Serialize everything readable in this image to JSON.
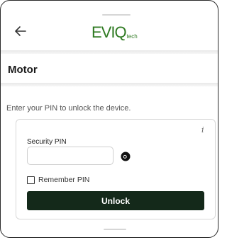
{
  "header": {
    "back_icon": "arrow-left-icon",
    "logo_main": "EVIQ",
    "logo_sub": "tech",
    "brand_color": "#2f7a22"
  },
  "page": {
    "title": "Motor",
    "hint": "Enter your PIN to unlock the device."
  },
  "pin_card": {
    "info_icon": "info-icon",
    "info_glyph": "i",
    "label": "Security PIN",
    "pin_value": "",
    "visibility_icon": "eye-icon",
    "remember_label": "Remember PIN",
    "remember_checked": false,
    "unlock_label": "Unlock",
    "button_color": "#14291a"
  }
}
